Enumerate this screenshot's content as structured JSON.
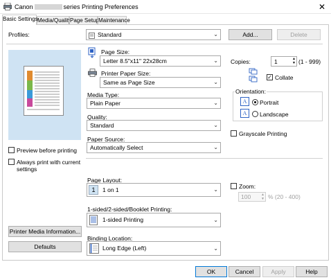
{
  "window": {
    "title_prefix": "Canon",
    "title_suffix": "series Printing Preferences",
    "close_glyph": "✕"
  },
  "tabs": [
    {
      "label": "Basic Settings",
      "active": true
    },
    {
      "label": "Media/Quality",
      "active": false
    },
    {
      "label": "Page Setup",
      "active": false
    },
    {
      "label": "Maintenance",
      "active": false
    }
  ],
  "profiles": {
    "label": "Profiles:",
    "selected": "Standard",
    "add_button": "Add...",
    "delete_button": "Delete"
  },
  "left": {
    "preview_before_printing": {
      "label": "Preview before printing",
      "checked": false
    },
    "always_print_current": {
      "label": "Always print with current settings",
      "checked": false
    },
    "printer_media_info_button": "Printer Media Information...",
    "defaults_button": "Defaults"
  },
  "page_size": {
    "label": "Page Size:",
    "selected": "Letter 8.5\"x11\" 22x28cm"
  },
  "printer_paper_size": {
    "label": "Printer Paper Size:",
    "selected": "Same as Page Size"
  },
  "media_type": {
    "label": "Media Type:",
    "selected": "Plain Paper"
  },
  "quality": {
    "label": "Quality:",
    "selected": "Standard"
  },
  "paper_source": {
    "label": "Paper Source:",
    "selected": "Automatically Select"
  },
  "copies": {
    "label": "Copies:",
    "value": "1",
    "range": "(1 - 999)"
  },
  "collate": {
    "label": "Collate",
    "checked": true
  },
  "orientation": {
    "label": "Orientation:",
    "portrait": {
      "label": "Portrait",
      "selected": true
    },
    "landscape": {
      "label": "Landscape",
      "selected": false
    }
  },
  "grayscale": {
    "label": "Grayscale Printing",
    "checked": false
  },
  "page_layout": {
    "label": "Page Layout:",
    "selected": "1 on 1",
    "icon_text": "1"
  },
  "zoom": {
    "label": "Zoom:",
    "checked": false,
    "value": "100",
    "range": "% (20 - 400)"
  },
  "duplex": {
    "label": "1-sided/2-sided/Booklet Printing:",
    "selected": "1-sided Printing"
  },
  "binding": {
    "label": "Binding Location:",
    "selected": "Long Edge (Left)"
  },
  "footer": {
    "ok": "OK",
    "cancel": "Cancel",
    "apply": "Apply",
    "help": "Help"
  },
  "icons": {
    "arrow": "⌄",
    "spin_up": "▲",
    "spin_down": "▼",
    "check": "✓"
  }
}
